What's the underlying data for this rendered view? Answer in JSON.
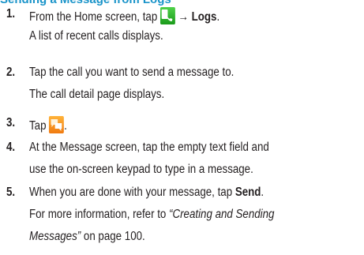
{
  "header_fragment": "Sending a Message from Logs",
  "steps": [
    {
      "number": "1.",
      "line1_pre": "From the Home screen, tap",
      "line1_arrow": "→",
      "line1_bold": "Logs",
      "line1_end": ".",
      "line2": "A list of recent calls displays.",
      "icon": "phone-icon"
    },
    {
      "number": "2.",
      "line1": "Tap the call you want to send a message to.",
      "line2": "The call detail page displays."
    },
    {
      "number": "3.",
      "line1_pre": "Tap",
      "line1_end": ".",
      "icon": "message-icon"
    },
    {
      "number": "4.",
      "line1": "At the Message screen, tap the empty text field and",
      "line2": "use the on-screen keypad to type in a message."
    },
    {
      "number": "5.",
      "line1_pre": "When you are done with your message, tap",
      "line1_bold": "Send",
      "line1_end": ".",
      "line2_pre": "For more information, refer to ",
      "line2_italic": "“Creating and Sending",
      "line3_italic": "Messages”",
      "line3_post": " on page 100."
    }
  ],
  "colors": {
    "text": "#231f20",
    "heading": "#1a94c9",
    "phone_icon": "#2fb62a",
    "message_icon": "#f59a1e"
  }
}
